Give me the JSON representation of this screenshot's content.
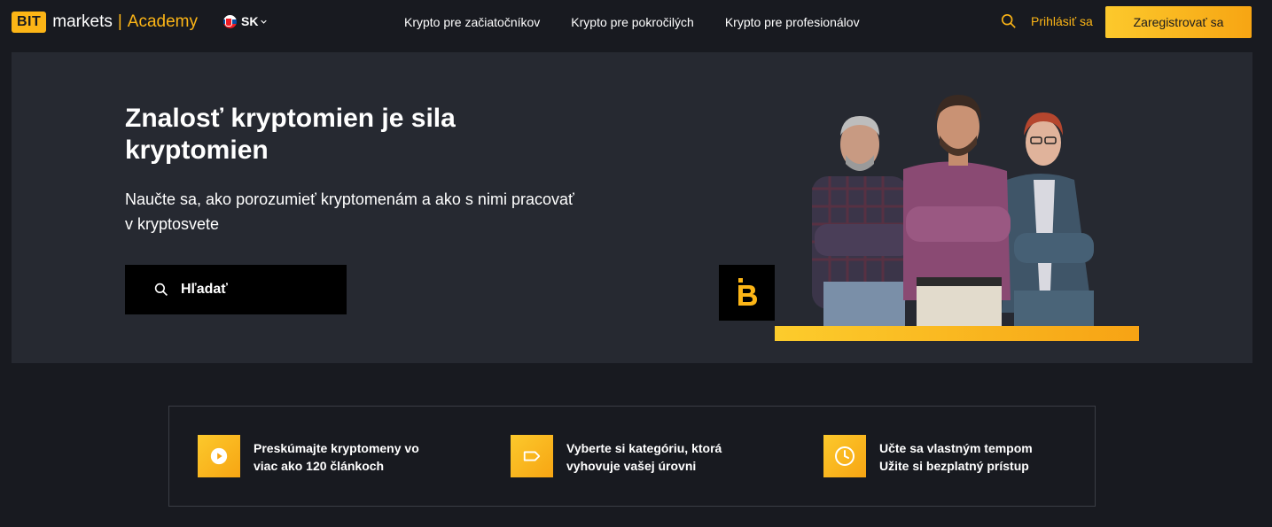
{
  "header": {
    "logo_badge": "BIT",
    "logo_markets": "markets",
    "logo_separator": "|",
    "logo_academy": "Academy",
    "language": "SK",
    "nav": [
      "Krypto pre začiatočníkov",
      "Krypto pre pokročilých",
      "Krypto pre profesionálov"
    ],
    "login": "Prihlásiť sa",
    "register": "Zaregistrovať sa"
  },
  "hero": {
    "title_line1": "Znalosť kryptomien je sila",
    "title_line2": "kryptomien",
    "subtitle_line1": "Naučte sa, ako porozumieť kryptomenám a ako s nimi pracovať",
    "subtitle_line2": "v kryptosvete",
    "search_label": "Hľadať"
  },
  "features": [
    {
      "icon": "play-icon",
      "line1": "Preskúmajte kryptomeny vo",
      "line2": "viac ako 120 článkoch"
    },
    {
      "icon": "tag-icon",
      "line1": "Vyberte si kategóriu, ktorá",
      "line2": "vyhovuje vašej úrovni"
    },
    {
      "icon": "clock-icon",
      "line1": "Učte sa vlastným tempom",
      "line2": "Užite si bezplatný prístup"
    }
  ],
  "colors": {
    "accent": "#fcb516",
    "background": "#181a20",
    "hero_background": "#262931"
  }
}
